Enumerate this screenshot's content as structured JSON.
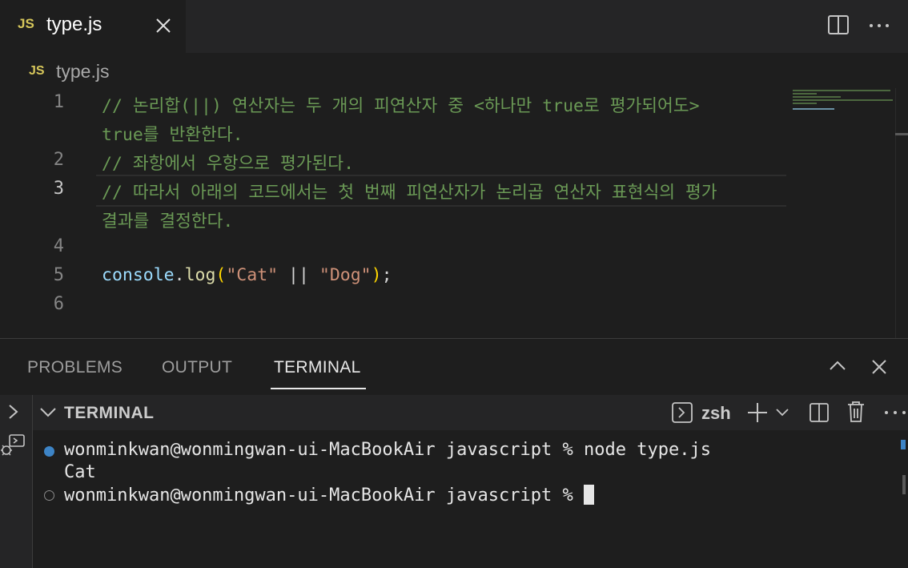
{
  "editor_tab": {
    "badge": "JS",
    "filename": "type.js"
  },
  "breadcrumb": {
    "badge": "JS",
    "filename": "type.js"
  },
  "code": {
    "line_numbers": [
      "1",
      "2",
      "3",
      "4",
      "5",
      "6"
    ],
    "line1_a": "// 논리합(||) 연산자는 두 개의 피연산자 중 <하나만 true로 평가되어도>",
    "line1_b": "true를 반환한다.",
    "line2": "// 좌항에서 우항으로 평가된다.",
    "line3_a": "// 따라서 아래의 코드에서는 첫 번째 피연산자가 논리곱 연산자 표현식의 평가",
    "line3_b": "결과를 결정한다.",
    "line5": {
      "obj": "console",
      "dot": ".",
      "fn": "log",
      "paren_open": "(",
      "str1": "\"Cat\"",
      "op": " || ",
      "str2": "\"Dog\"",
      "paren_close": ")",
      "semi": ";"
    }
  },
  "panel": {
    "tabs": [
      "PROBLEMS",
      "OUTPUT",
      "TERMINAL"
    ],
    "active_tab": "TERMINAL",
    "terminal_header": "TERMINAL",
    "shell_name": "zsh"
  },
  "terminal": {
    "line1": "wonminkwan@wonmingwan-ui-MacBookAir javascript % node type.js",
    "line2": "Cat",
    "line3": "wonminkwan@wonmingwan-ui-MacBookAir javascript % "
  },
  "colors": {
    "comment": "#6a9955",
    "string": "#ce9178",
    "function": "#dcdcaa",
    "variable": "#9cdcfe",
    "js_badge": "#d7c75b"
  }
}
